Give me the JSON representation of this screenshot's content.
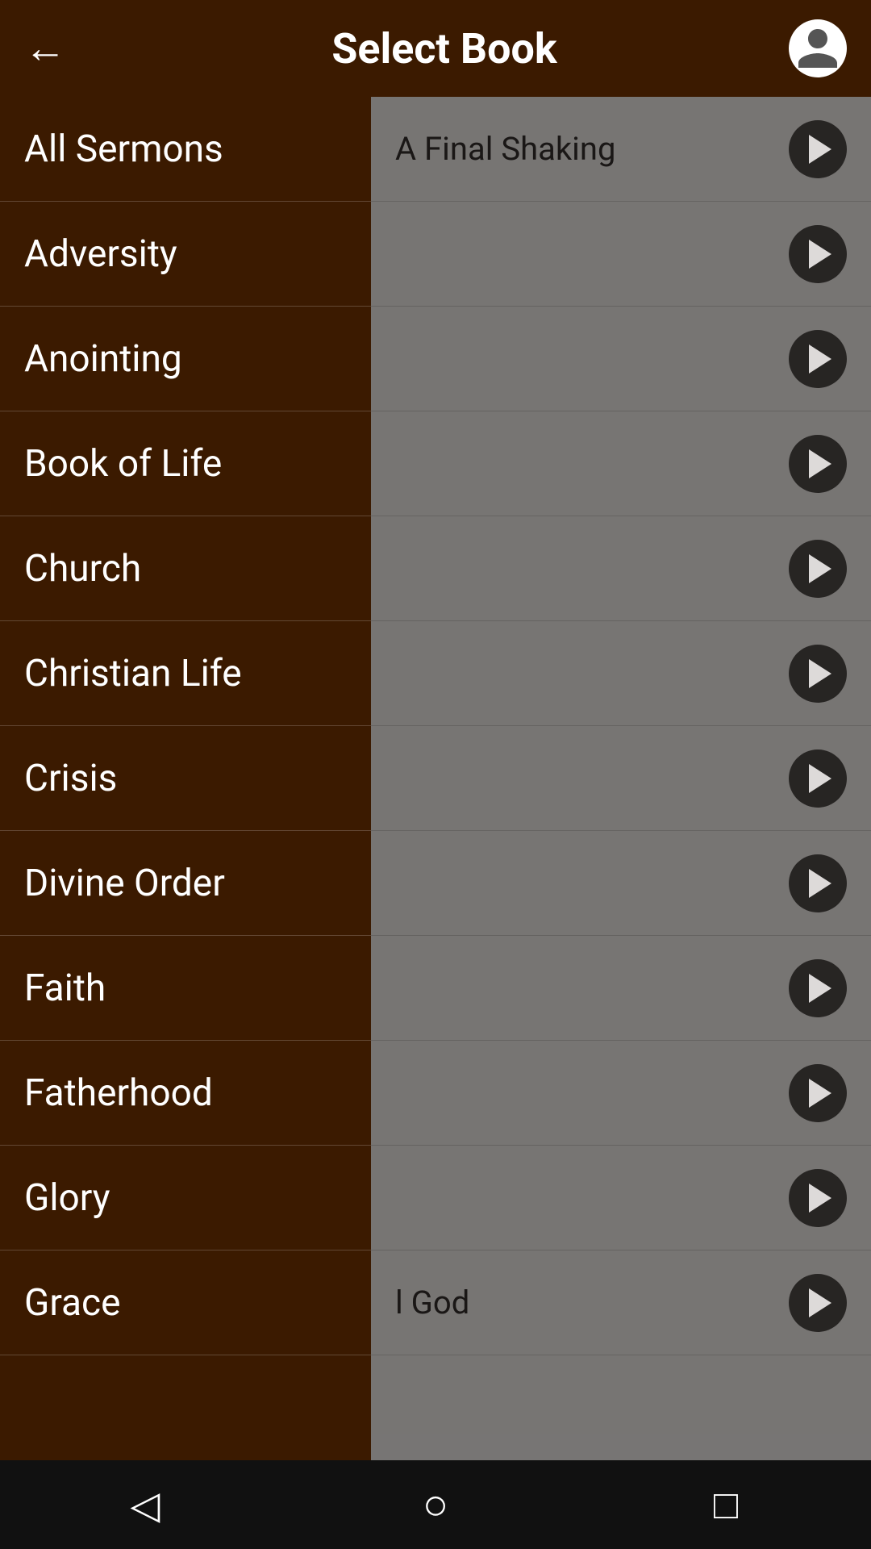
{
  "header": {
    "back_label": "←",
    "title": "Select Book",
    "profile_icon": "person-icon"
  },
  "book_list": {
    "items": [
      {
        "id": "all-sermons",
        "label": "All Sermons"
      },
      {
        "id": "adversity",
        "label": "Adversity"
      },
      {
        "id": "anointing",
        "label": "Anointing"
      },
      {
        "id": "book-of-life",
        "label": "Book of Life"
      },
      {
        "id": "church",
        "label": "Church"
      },
      {
        "id": "christian-life",
        "label": "Christian Life"
      },
      {
        "id": "crisis",
        "label": "Crisis"
      },
      {
        "id": "divine-order",
        "label": "Divine Order"
      },
      {
        "id": "faith",
        "label": "Faith"
      },
      {
        "id": "fatherhood",
        "label": "Fatherhood"
      },
      {
        "id": "glory",
        "label": "Glory"
      },
      {
        "id": "grace",
        "label": "Grace"
      }
    ]
  },
  "sermon_list": {
    "items": [
      {
        "id": "sermon-1",
        "title": "A Final Shaking"
      },
      {
        "id": "sermon-2",
        "title": ""
      },
      {
        "id": "sermon-3",
        "title": ""
      },
      {
        "id": "sermon-4",
        "title": ""
      },
      {
        "id": "sermon-5",
        "title": ""
      },
      {
        "id": "sermon-6",
        "title": ""
      },
      {
        "id": "sermon-7",
        "title": ""
      },
      {
        "id": "sermon-8",
        "title": ""
      },
      {
        "id": "sermon-9",
        "title": ""
      },
      {
        "id": "sermon-10",
        "title": ""
      },
      {
        "id": "sermon-11",
        "title": ""
      },
      {
        "id": "sermon-12",
        "title": "l God"
      }
    ]
  },
  "nav_bar": {
    "back_label": "◁",
    "home_label": "○",
    "recents_label": "□"
  }
}
